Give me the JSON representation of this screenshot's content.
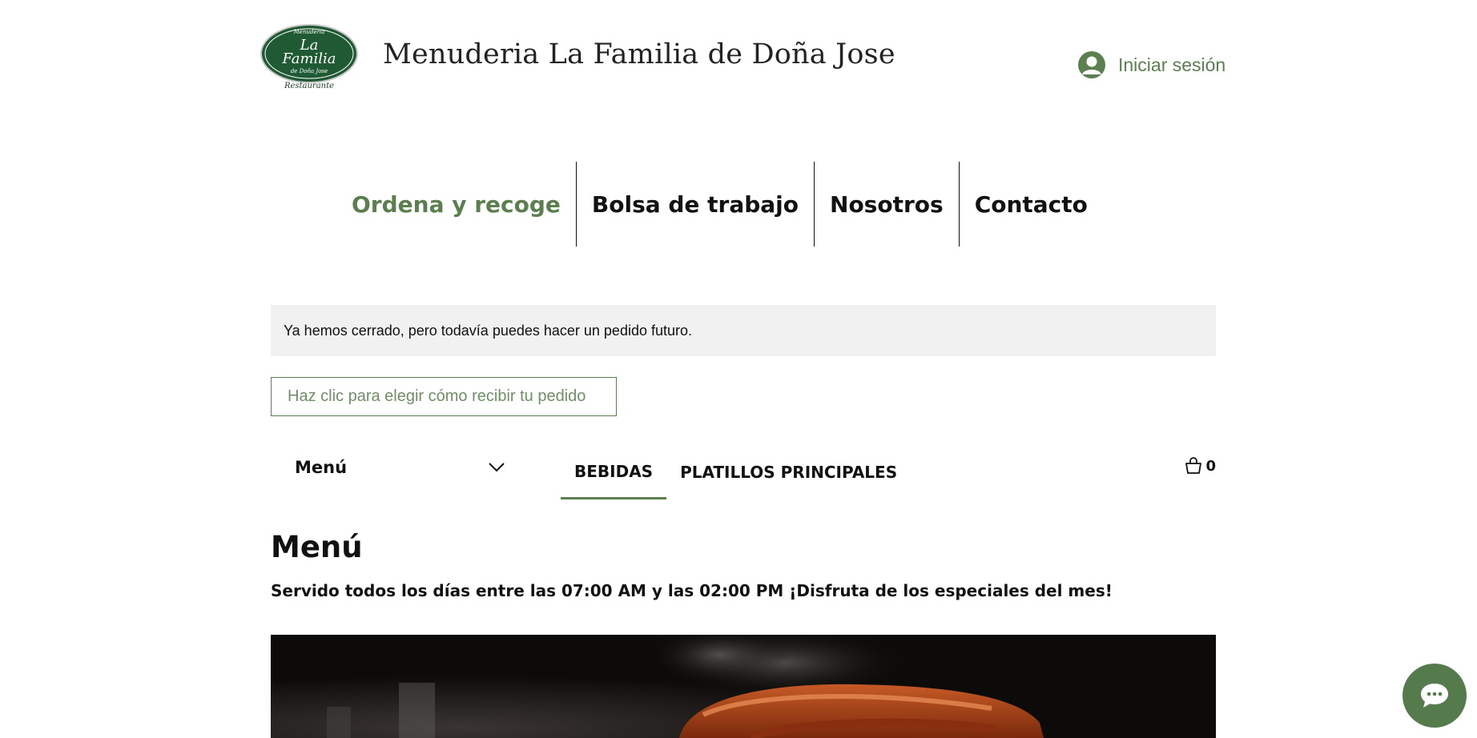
{
  "header": {
    "logo": {
      "line1": "Menuderia",
      "line2": "La",
      "line3": "Familia",
      "line4": "de Doña Jose",
      "line5": "Restaurante"
    },
    "title": "Menuderia La Familia de Doña Jose",
    "login_label": "Iniciar sesión"
  },
  "nav": {
    "items": [
      {
        "label": "Ordena y recoge"
      },
      {
        "label": "Bolsa de trabajo"
      },
      {
        "label": "Nosotros"
      },
      {
        "label": "Contacto"
      }
    ]
  },
  "notice": {
    "text": "Ya hemos cerrado, pero todavía puedes hacer un pedido futuro."
  },
  "pickup": {
    "label": "Haz clic para elegir cómo recibir tu pedido"
  },
  "menubar": {
    "selected_menu": "Menú",
    "tabs": [
      {
        "label": "BEBIDAS"
      },
      {
        "label": "PLATILLOS PRINCIPALES"
      }
    ],
    "cart_count": "0"
  },
  "section": {
    "title": "Menú",
    "description": "Servido todos los días entre las 07:00 AM y las 02:00 PM ¡Disfruta de los especiales del mes!"
  },
  "colors": {
    "accent": "#5b7f4f",
    "notice_bg": "#f1f1f1",
    "chat_bg": "#557a4c",
    "logo_green": "#1f5a34"
  },
  "icons": {
    "login": "user-avatar-icon",
    "dropdown": "chevron-down-icon",
    "cart": "shopping-bag-icon",
    "chat": "chat-bubble-icon"
  }
}
